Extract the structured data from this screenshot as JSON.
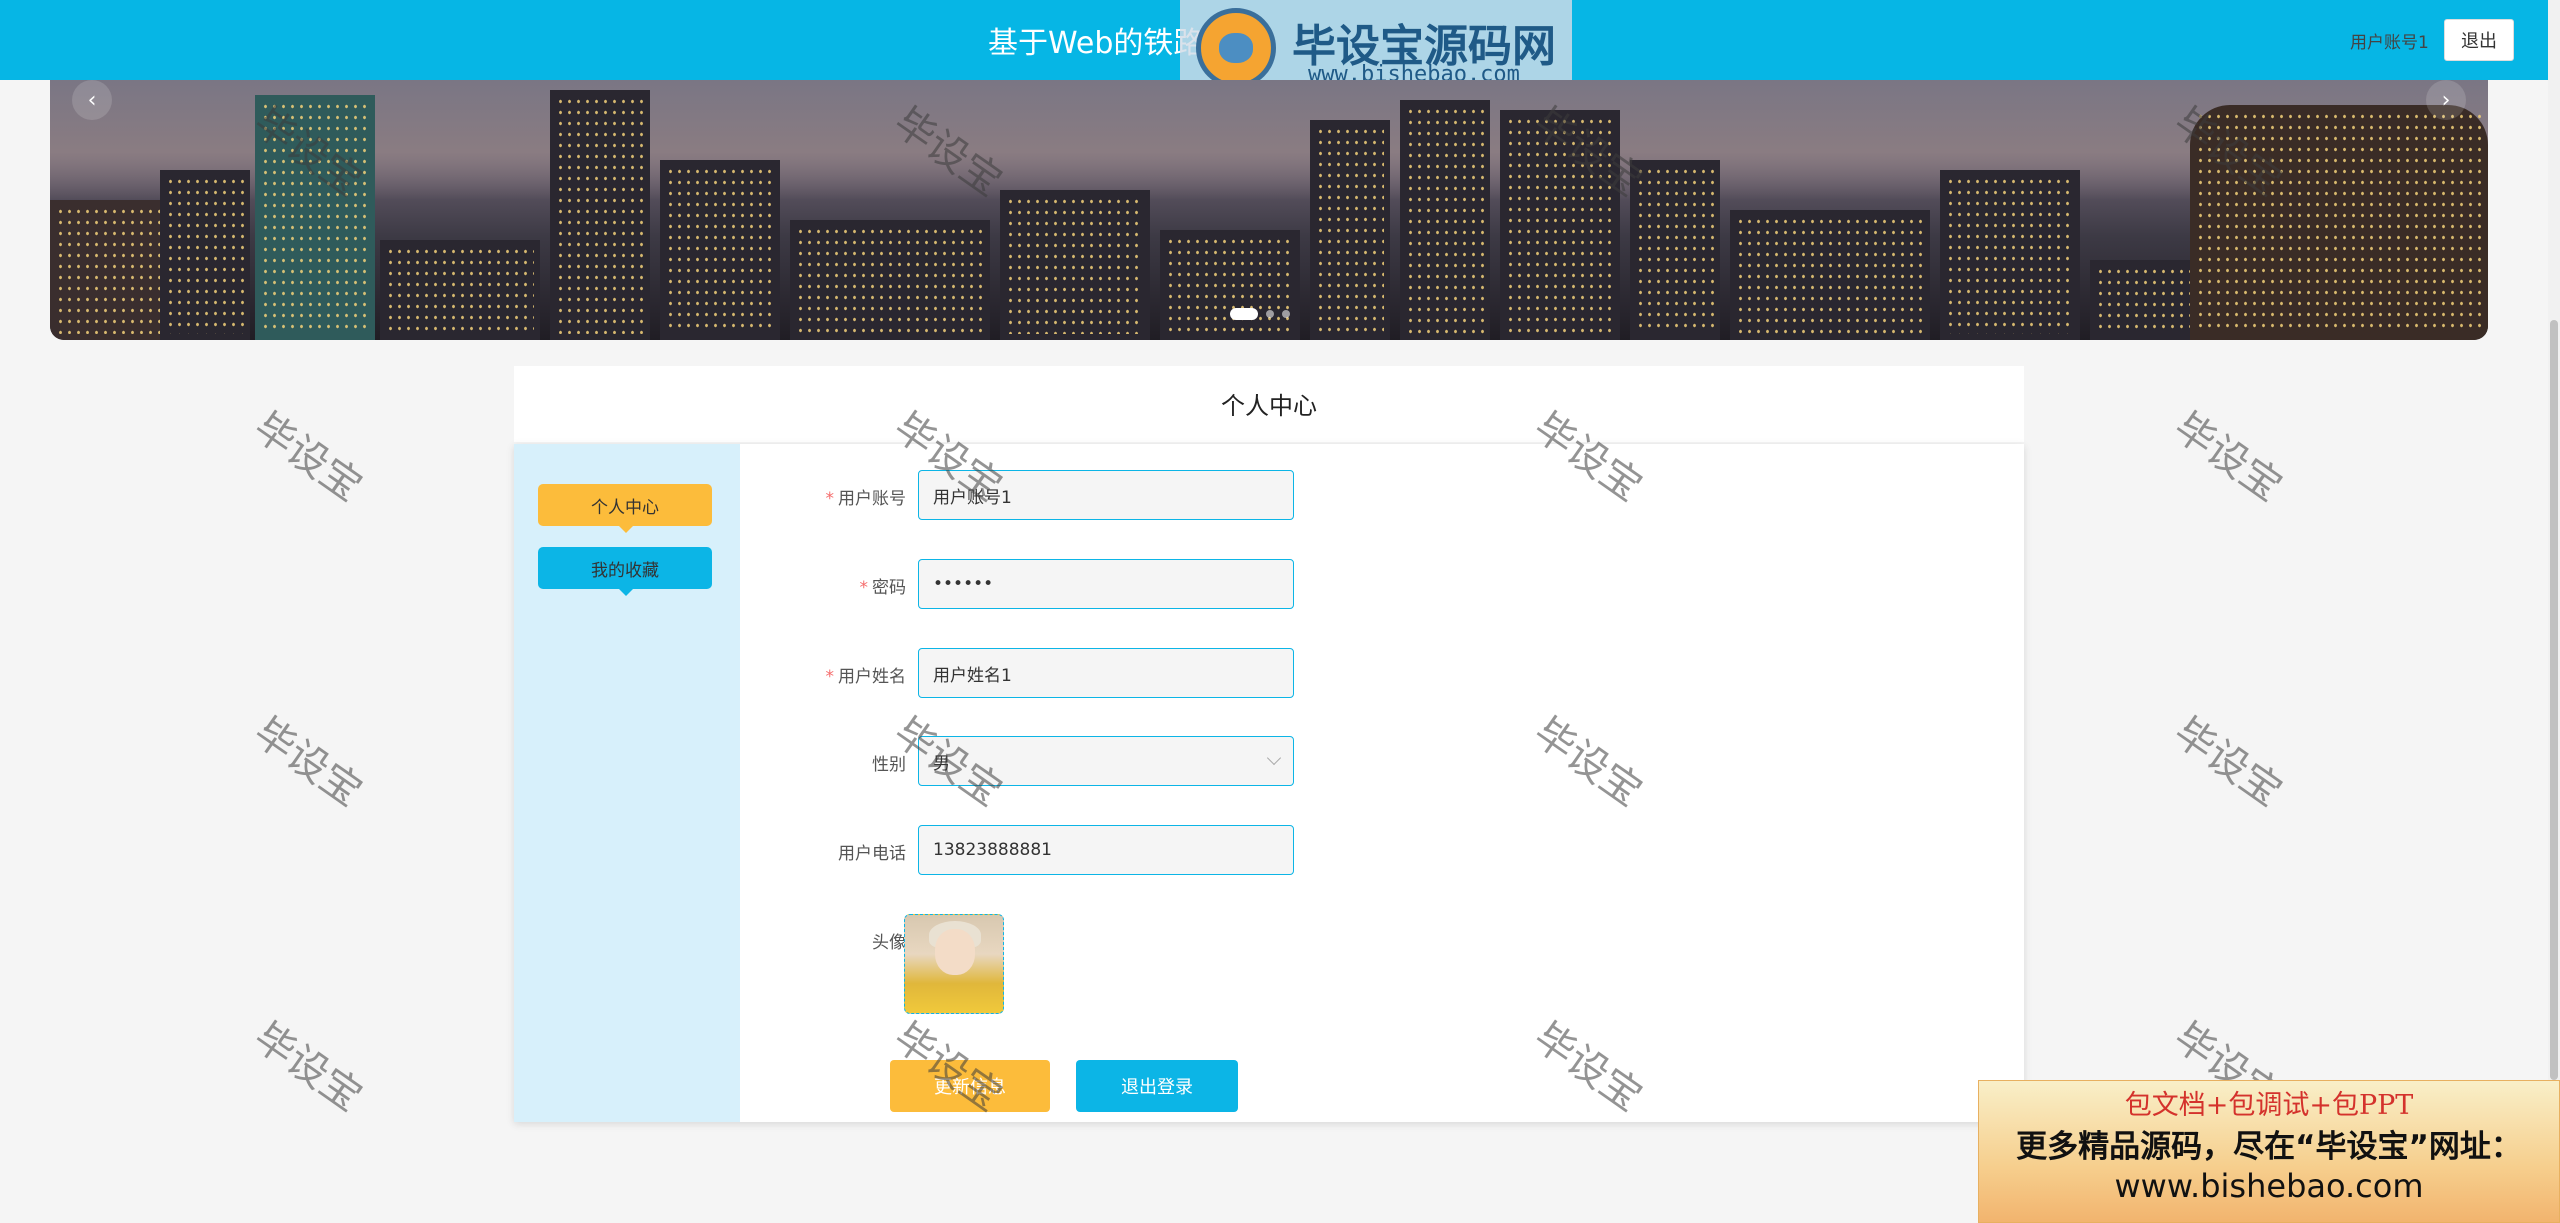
{
  "header": {
    "site_title": "基于Web的铁路",
    "username": "用户账号1",
    "logout_label": "退出"
  },
  "watermark_logo": {
    "brand": "毕设宝源码网",
    "url": "www.bishebao.com"
  },
  "banner": {
    "prev_arrow": "‹",
    "next_arrow": "›",
    "slide_count": 3,
    "active_slide": 1
  },
  "page": {
    "title": "个人中心"
  },
  "sidebar": {
    "items": [
      {
        "label": "个人中心",
        "color": "#fcbc3b"
      },
      {
        "label": "我的收藏",
        "color": "#0cb5e6"
      }
    ]
  },
  "form": {
    "account": {
      "label": "用户账号",
      "required": true,
      "value": "用户账号1"
    },
    "password": {
      "label": "密码",
      "required": true,
      "value": "••••••"
    },
    "name": {
      "label": "用户姓名",
      "required": true,
      "value": "用户姓名1"
    },
    "gender": {
      "label": "性别",
      "required": false,
      "value": "男"
    },
    "phone": {
      "label": "用户电话",
      "required": false,
      "value": "13823888881"
    },
    "avatar": {
      "label": "头像"
    }
  },
  "actions": {
    "update_label": "更新信息",
    "logout_label": "退出登录"
  },
  "watermark_text": "毕设宝",
  "ad": {
    "line1": "包文档+包调试+包PPT",
    "line2": "更多精品源码，尽在“毕设宝”网址：",
    "line3": "www.bishebao.com"
  },
  "colors": {
    "primary": "#0cb5e6",
    "accent": "#fcbc3b",
    "required": "#f56c6c"
  }
}
